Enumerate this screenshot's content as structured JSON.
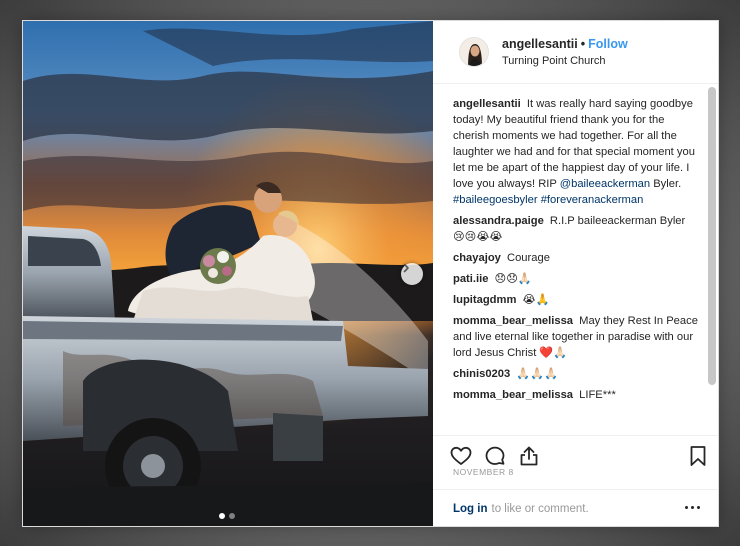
{
  "post": {
    "username": "angellesantii",
    "separator": "•",
    "follow_label": "Follow",
    "location": "Turning Point Church"
  },
  "caption": {
    "user": "angellesantii",
    "text": "It was really hard saying goodbye today! My beautiful friend thank you for the cherish moments we had together. For all the laughter we had and for that special moment you let me be apart of the happiest day of your life. I love you always! RIP",
    "mention": "@baileeackerman",
    "after_mention": "Byler.",
    "hashtag1": "#baileegoesbyler",
    "hashtag2": "#foreveranackerman"
  },
  "comments": [
    {
      "user": "alessandra.paige",
      "text": "R.I.P baileeackerman Byler 😢😢😭😭"
    },
    {
      "user": "chayajoy",
      "text": "Courage"
    },
    {
      "user": "pati.iie",
      "text": "😞😞🙏🏻"
    },
    {
      "user": "lupitagdmm",
      "text": "😭🙏"
    },
    {
      "user": "momma_bear_melissa",
      "text": "May they Rest In Peace and live eternal like together in paradise with our lord Jesus Christ ❤️🙏🏻"
    },
    {
      "user": "chinis0203",
      "text": "🙏🏻🙏🏻🙏🏻"
    },
    {
      "user": "momma_bear_melissa",
      "text": "LIFE***"
    }
  ],
  "date": "NOVEMBER 8",
  "footer": {
    "login_label": "Log in",
    "rest": "to like or comment."
  },
  "icons": {
    "like": "heart-icon",
    "comment": "comment-icon",
    "share": "share-icon",
    "save": "bookmark-icon",
    "more": "more-options-icon",
    "next": "chevron-right-icon"
  },
  "colors": {
    "follow": "#3897f0",
    "link": "#003569",
    "text": "#262626",
    "muted": "#999999"
  }
}
